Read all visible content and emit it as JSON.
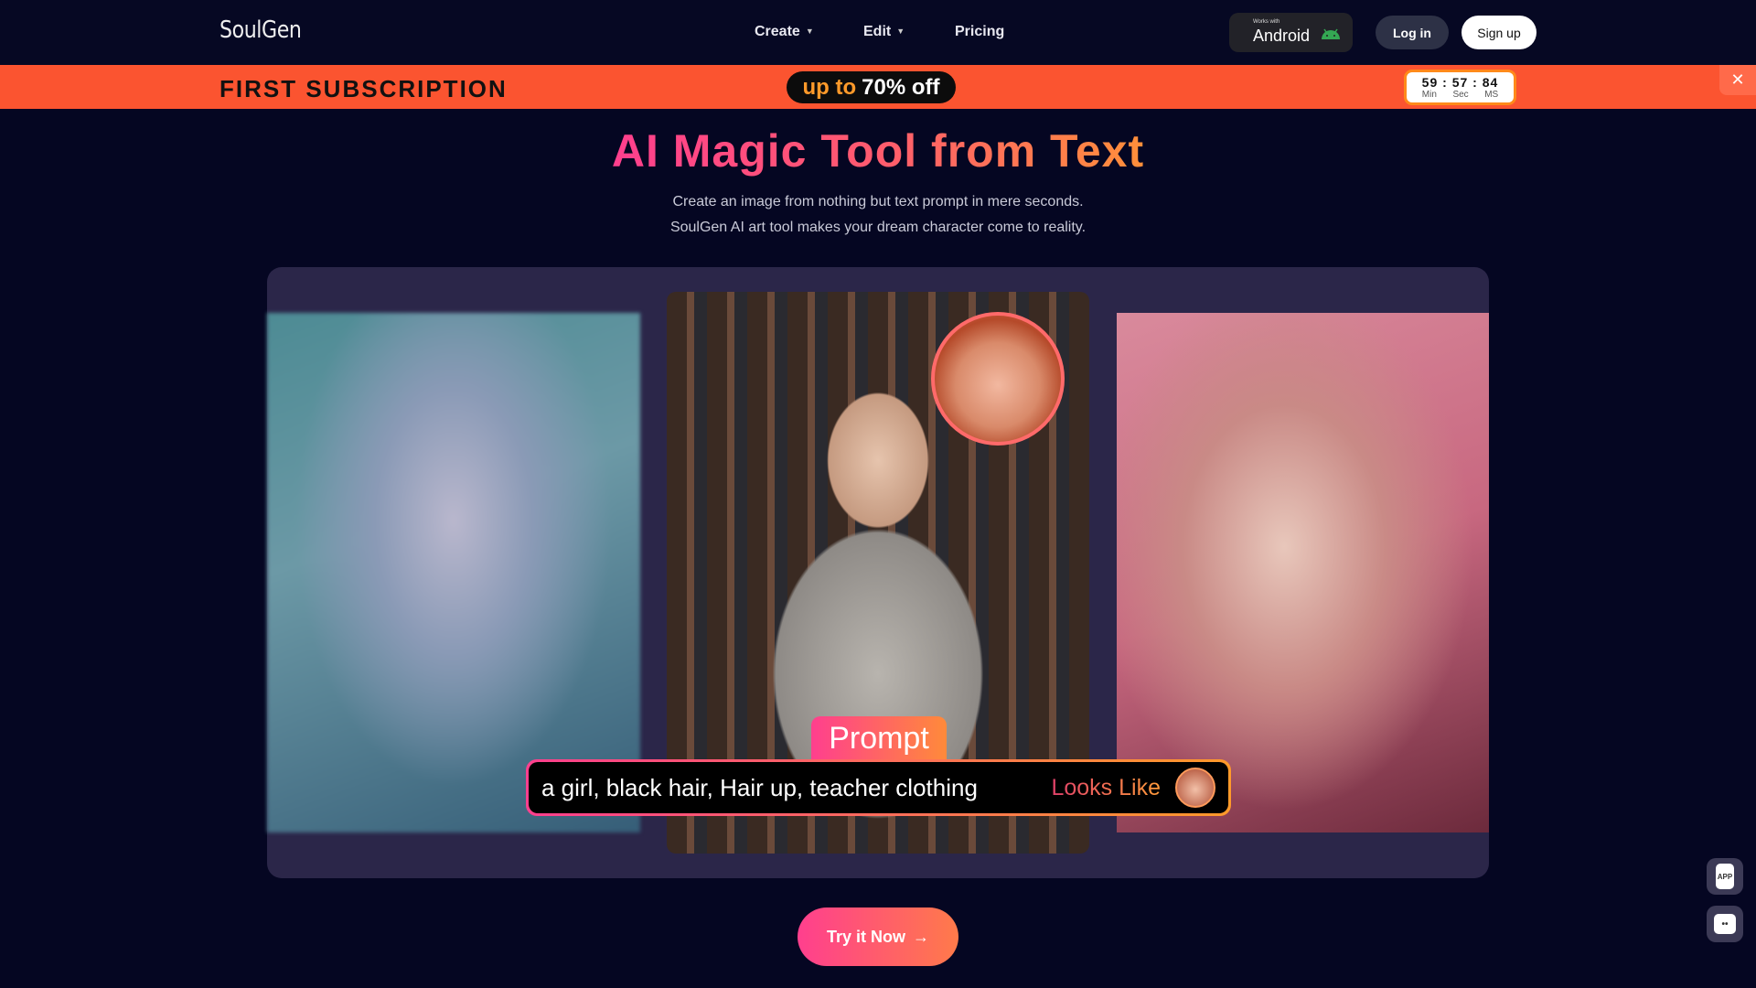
{
  "nav": {
    "logo": "SoulGen",
    "items": [
      {
        "label": "Create"
      },
      {
        "label": "Edit"
      },
      {
        "label": "Pricing"
      }
    ],
    "android_small": "Works with",
    "android": "Android",
    "login": "Log in",
    "signup": "Sign up"
  },
  "banner": {
    "headline": "FIRST SUBSCRIPTION",
    "pill_a": "up to",
    "pill_b": "70% off",
    "timer": {
      "min": "59",
      "sec": "57",
      "ms": "84",
      "sep": ":",
      "labels": [
        "Min",
        "Sec",
        "MS"
      ]
    },
    "close": "✕"
  },
  "hero": {
    "title": "AI Magic Tool from Text",
    "subtitle_1": "Create an image from nothing but text prompt in mere seconds.",
    "subtitle_2": "SoulGen AI art tool makes your dream character come to reality."
  },
  "demo": {
    "prompt_label": "Prompt",
    "prompt_text": "a girl, black hair, Hair up, teacher clothing",
    "looks_like": "Looks Like"
  },
  "cta": {
    "label": "Try it Now",
    "arrow": "→"
  },
  "side": {
    "app": "APP"
  },
  "colors": {
    "banner": "#fb5430",
    "accent_pink": "#ff3f8e",
    "accent_orange": "#ff8a3a",
    "bg": "#050622"
  }
}
